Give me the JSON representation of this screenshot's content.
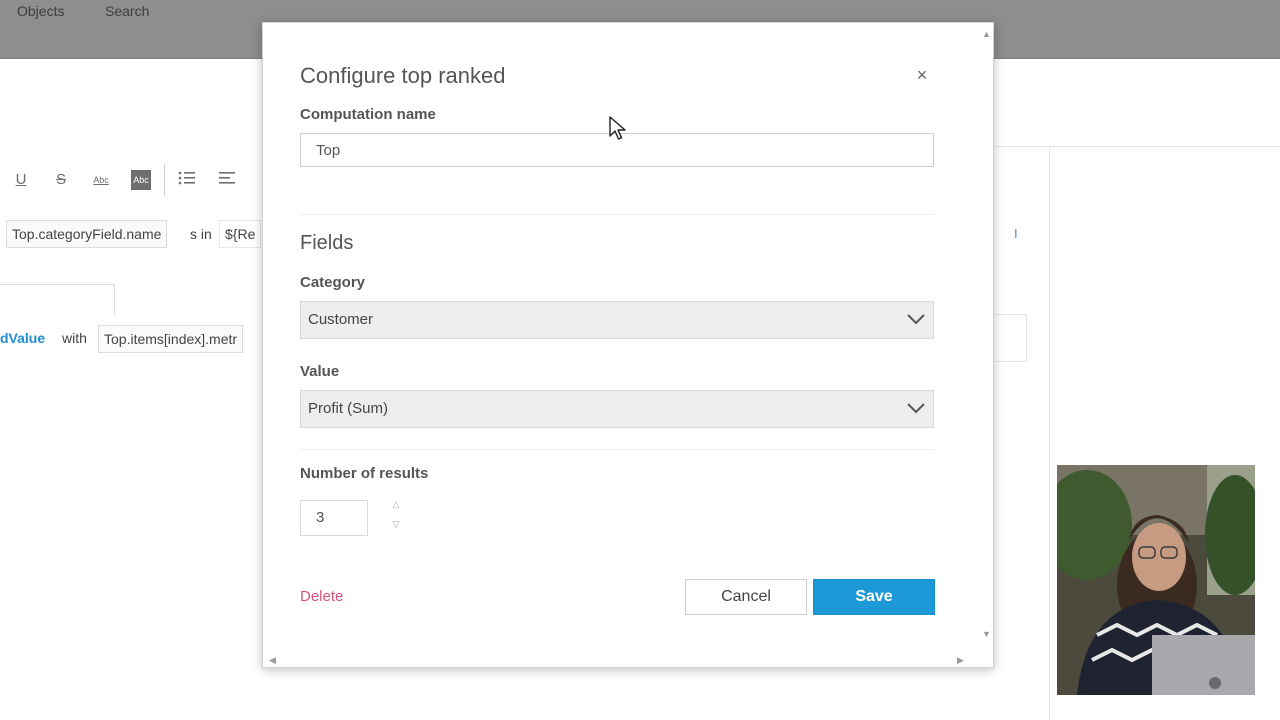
{
  "background": {
    "menu": [
      "Objects",
      "Search"
    ],
    "toolbar_icons": [
      "underline-icon",
      "strikethrough-icon",
      "abc-text-icon",
      "abc-highlight-icon",
      "bulleted-list-icon",
      "align-left-icon"
    ],
    "chip_category_field": "Top.categoryField.name",
    "text_s_in": "s in",
    "text_var": "${Re",
    "text_dvalue": "dValue",
    "text_with": "with",
    "chip_items_metric": "Top.items[index].metr",
    "cursor_glyph": "I"
  },
  "dialog": {
    "title": "Configure top ranked",
    "close_glyph": "×",
    "computation_name_label": "Computation name",
    "computation_name_value": "Top",
    "fields_title": "Fields",
    "category_label": "Category",
    "category_value": "Customer",
    "value_label": "Value",
    "value_value": "Profit (Sum)",
    "number_of_results_label": "Number of results",
    "number_of_results_value": "3",
    "delete_label": "Delete",
    "cancel_label": "Cancel",
    "save_label": "Save"
  },
  "colors": {
    "save": "#1d99d7",
    "delete": "#d6547e",
    "link_blue": "#1e8fd0"
  }
}
